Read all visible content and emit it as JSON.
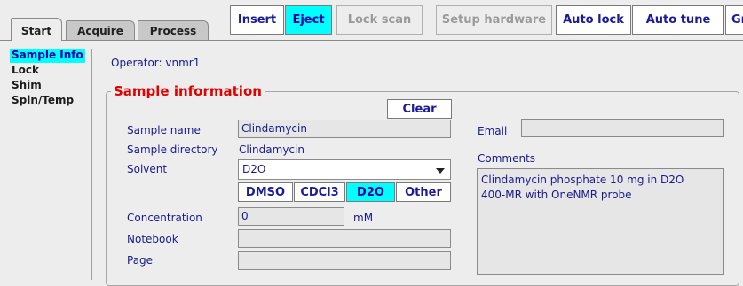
{
  "tabs": [
    {
      "label": "Start",
      "active": true
    },
    {
      "label": "Acquire",
      "active": false
    },
    {
      "label": "Process",
      "active": false
    }
  ],
  "toolbar": {
    "insert": "Insert",
    "eject": "Eject",
    "lock_scan": "Lock scan",
    "setup_hardware": "Setup hardware",
    "auto_lock": "Auto lock",
    "auto_tune": "Auto tune",
    "clipped": "Gr"
  },
  "nav": {
    "items": [
      "Sample Info",
      "Lock",
      "Shim",
      "Spin/Temp"
    ],
    "selected": "Sample Info"
  },
  "operator": "Operator: vnmr1",
  "sample": {
    "group_title": "Sample information",
    "clear": "Clear",
    "name_label": "Sample name",
    "name_value": "Clindamycin",
    "dir_label": "Sample directory",
    "dir_value": "Clindamycin",
    "solvent_label": "Solvent",
    "solvent_value": "D2O",
    "solvent_buttons": [
      "DMSO",
      "CDCl3",
      "D2O",
      "Other"
    ],
    "solvent_selected": "D2O",
    "concentration_label": "Concentration",
    "concentration_value": "0",
    "concentration_unit": "mM",
    "notebook_label": "Notebook",
    "notebook_value": "",
    "page_label": "Page",
    "page_value": "",
    "email_label": "Email",
    "email_value": "",
    "comments_label": "Comments",
    "comments_value": "Clindamycin phosphate 10 mg in D2O\n400-MR with OneNMR probe"
  },
  "colors": {
    "accent_selected": "#00ffff",
    "label_text": "#1a1a8c",
    "group_title": "#e00000"
  }
}
